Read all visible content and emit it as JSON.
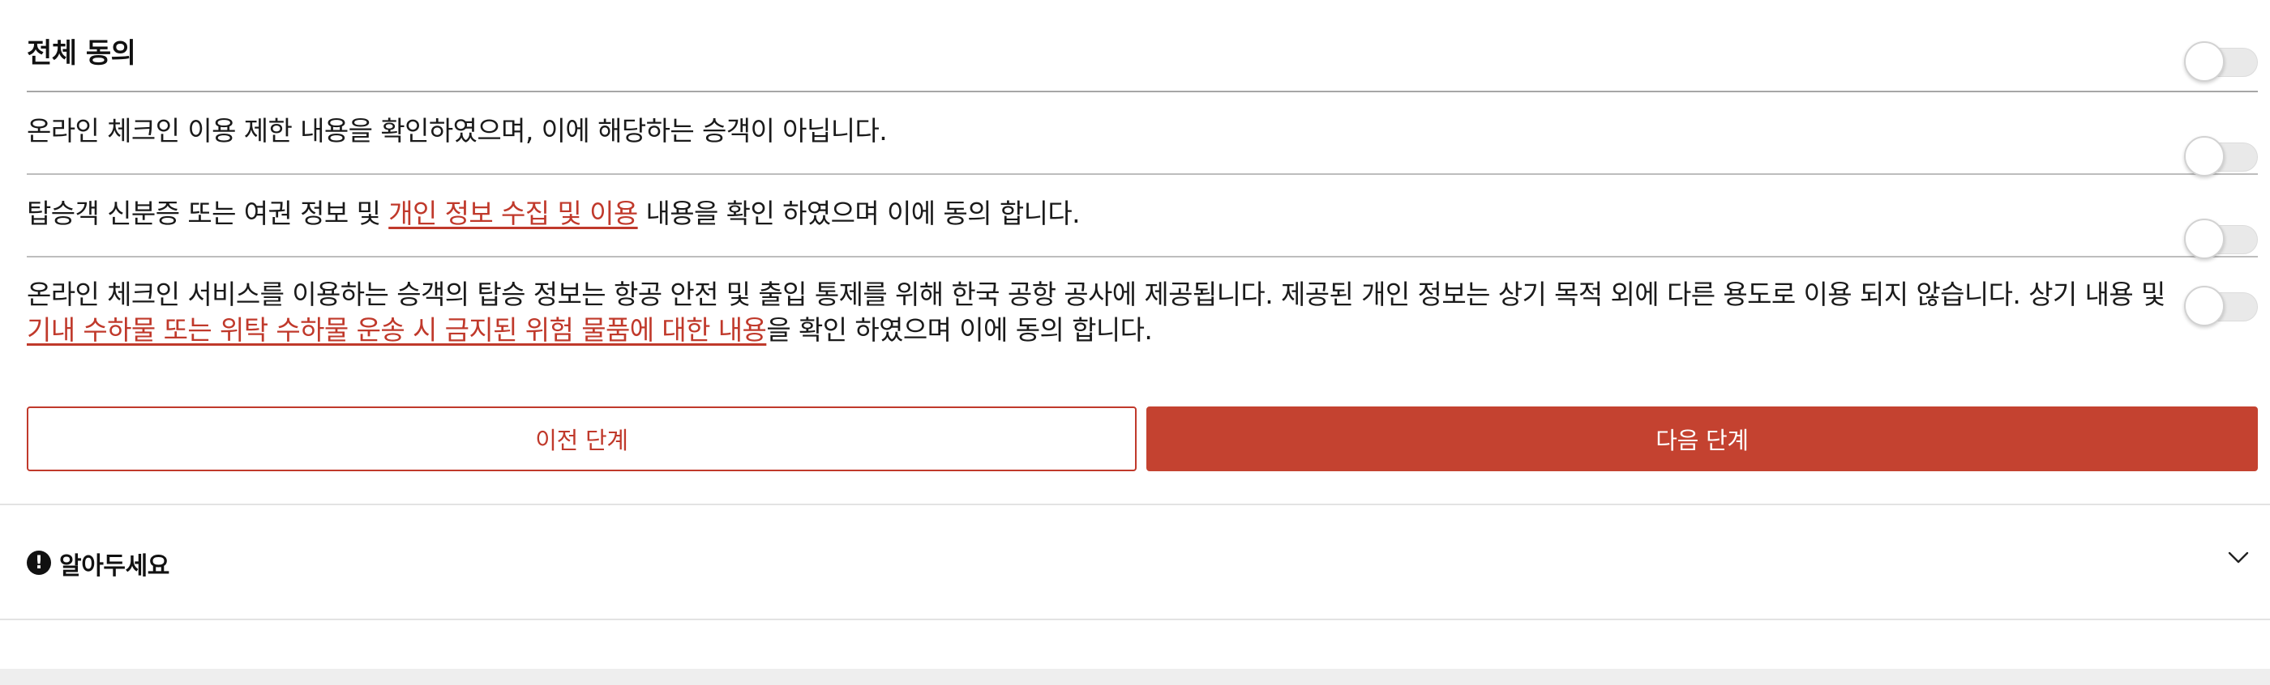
{
  "agreements": {
    "all": {
      "label": "전체 동의",
      "checked": false
    },
    "items": [
      {
        "text_before": "온라인 체크인 이용 제한 내용을 확인하였으며, 이에 해당하는 승객이 아닙니다.",
        "link": "",
        "text_after": "",
        "checked": false
      },
      {
        "text_before": "탑승객 신분증 또는 여권 정보 및 ",
        "link": "개인 정보 수집 및 이용",
        "text_after": " 내용을 확인 하였으며 이에 동의 합니다.",
        "checked": false
      },
      {
        "text_before": "온라인 체크인 서비스를 이용하는 승객의 탑승 정보는 항공 안전 및 출입 통제를 위해 한국 공항 공사에 제공됩니다. 제공된 개인 정보는 상기 목적 외에 다른 용도로 이용 되지 않습니다. 상기 내용 및 ",
        "link": "기내 수하물 또는 위탁 수하물 운송 시 금지된 위험 물품에 대한 내용",
        "text_after": "을 확인 하였으며 이에 동의 합니다.",
        "checked": false
      }
    ]
  },
  "buttons": {
    "prev_label": "이전 단계",
    "next_label": "다음 단계"
  },
  "notice": {
    "icon": "exclamation-circle-icon",
    "icon_glyph": "!",
    "label": "알아두세요",
    "chevron_icon": "chevron-down-icon"
  },
  "colors": {
    "accent": "#c44230",
    "link": "#c0392b",
    "toggle_off": "#e9e9e9"
  }
}
